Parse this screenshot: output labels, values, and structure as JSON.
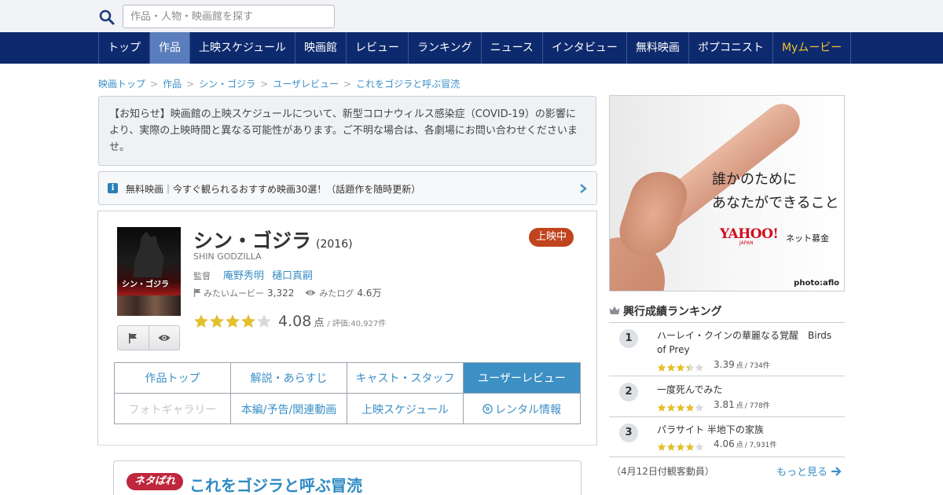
{
  "search": {
    "placeholder": "作品・人物・映画館を探す"
  },
  "nav": {
    "items": [
      "トップ",
      "作品",
      "上映スケジュール",
      "映画館",
      "レビュー",
      "ランキング",
      "ニュース",
      "インタビュー",
      "無料映画",
      "ポプコニスト",
      "Myムービー"
    ],
    "active_index": 1
  },
  "breadcrumb": [
    "映画トップ",
    "作品",
    "シン・ゴジラ",
    "ユーザレビュー",
    "これをゴジラと呼ぶ冒涜"
  ],
  "notice": {
    "text": "【お知らせ】映画館の上映スケジュールについて、新型コロナウィルス感染症（COVID-19）の影響により、実際の上映時間と異なる可能性があります。ご不明な場合は、各劇場にお問い合わせくださいませ。"
  },
  "free_banner": {
    "icon": "info-icon",
    "text": "無料映画｜今すぐ観られるおすすめ映画30選！（話題作を随時更新）"
  },
  "movie": {
    "poster_title": "シン・ゴジラ",
    "title": "シン・ゴジラ",
    "year": "(2016)",
    "title_en": "SHIN GODZILLA",
    "status_badge": "上映中",
    "director_label": "監督",
    "directors": [
      "庵野秀明",
      "樋口真嗣"
    ],
    "want_label": "みたいムービー",
    "want_count": "3,322",
    "seen_label": "みたログ",
    "seen_count": "4.6万",
    "rating": 4.08,
    "rating_text": "4.08",
    "rating_unit": "点",
    "rating_count_text": "/ 評価:40,927件"
  },
  "tabs": [
    {
      "label": "作品トップ",
      "state": "normal"
    },
    {
      "label": "解説・あらすじ",
      "state": "normal"
    },
    {
      "label": "キャスト・スタッフ",
      "state": "normal"
    },
    {
      "label": "ユーザーレビュー",
      "state": "active"
    },
    {
      "label": "フォトギャラリー",
      "state": "disabled"
    },
    {
      "label": "本編/予告/関連動画",
      "state": "normal"
    },
    {
      "label": "上映スケジュール",
      "state": "normal"
    },
    {
      "label": "レンタル情報",
      "state": "normal"
    }
  ],
  "review": {
    "spoiler_label": "ネタばれ",
    "title": "これをゴジラと呼ぶ冒涜"
  },
  "ad": {
    "copy_line1": "誰かのために",
    "copy_line2": "あなたができること",
    "brand": "YAHOO!",
    "brand_sub": "JAPAN",
    "service": "ネット募金",
    "credit": "photo:aflo"
  },
  "ranking": {
    "title": "興行成績ランキング",
    "items": [
      {
        "rank": "1",
        "title": "ハーレイ・クインの華麗なる覚醒　Birds of Prey",
        "rating": 3.39,
        "score": "3.39",
        "unit": "点",
        "count": "/ 734件"
      },
      {
        "rank": "2",
        "title": "一度死んでみた",
        "rating": 3.81,
        "score": "3.81",
        "unit": "点",
        "count": "/ 778件"
      },
      {
        "rank": "3",
        "title": "パラサイト 半地下の家族",
        "rating": 4.06,
        "score": "4.06",
        "unit": "点",
        "count": "/ 7,931件"
      }
    ],
    "note": "（4月12日付観客動員）",
    "more": "もっと見る"
  },
  "colors": {
    "nav_bg": "#0e2a6e",
    "nav_active": "#5a7dbd",
    "link": "#3b8fc6",
    "badge": "#c0441e",
    "star": "#e3c02a",
    "spoiler": "#c0263c"
  }
}
